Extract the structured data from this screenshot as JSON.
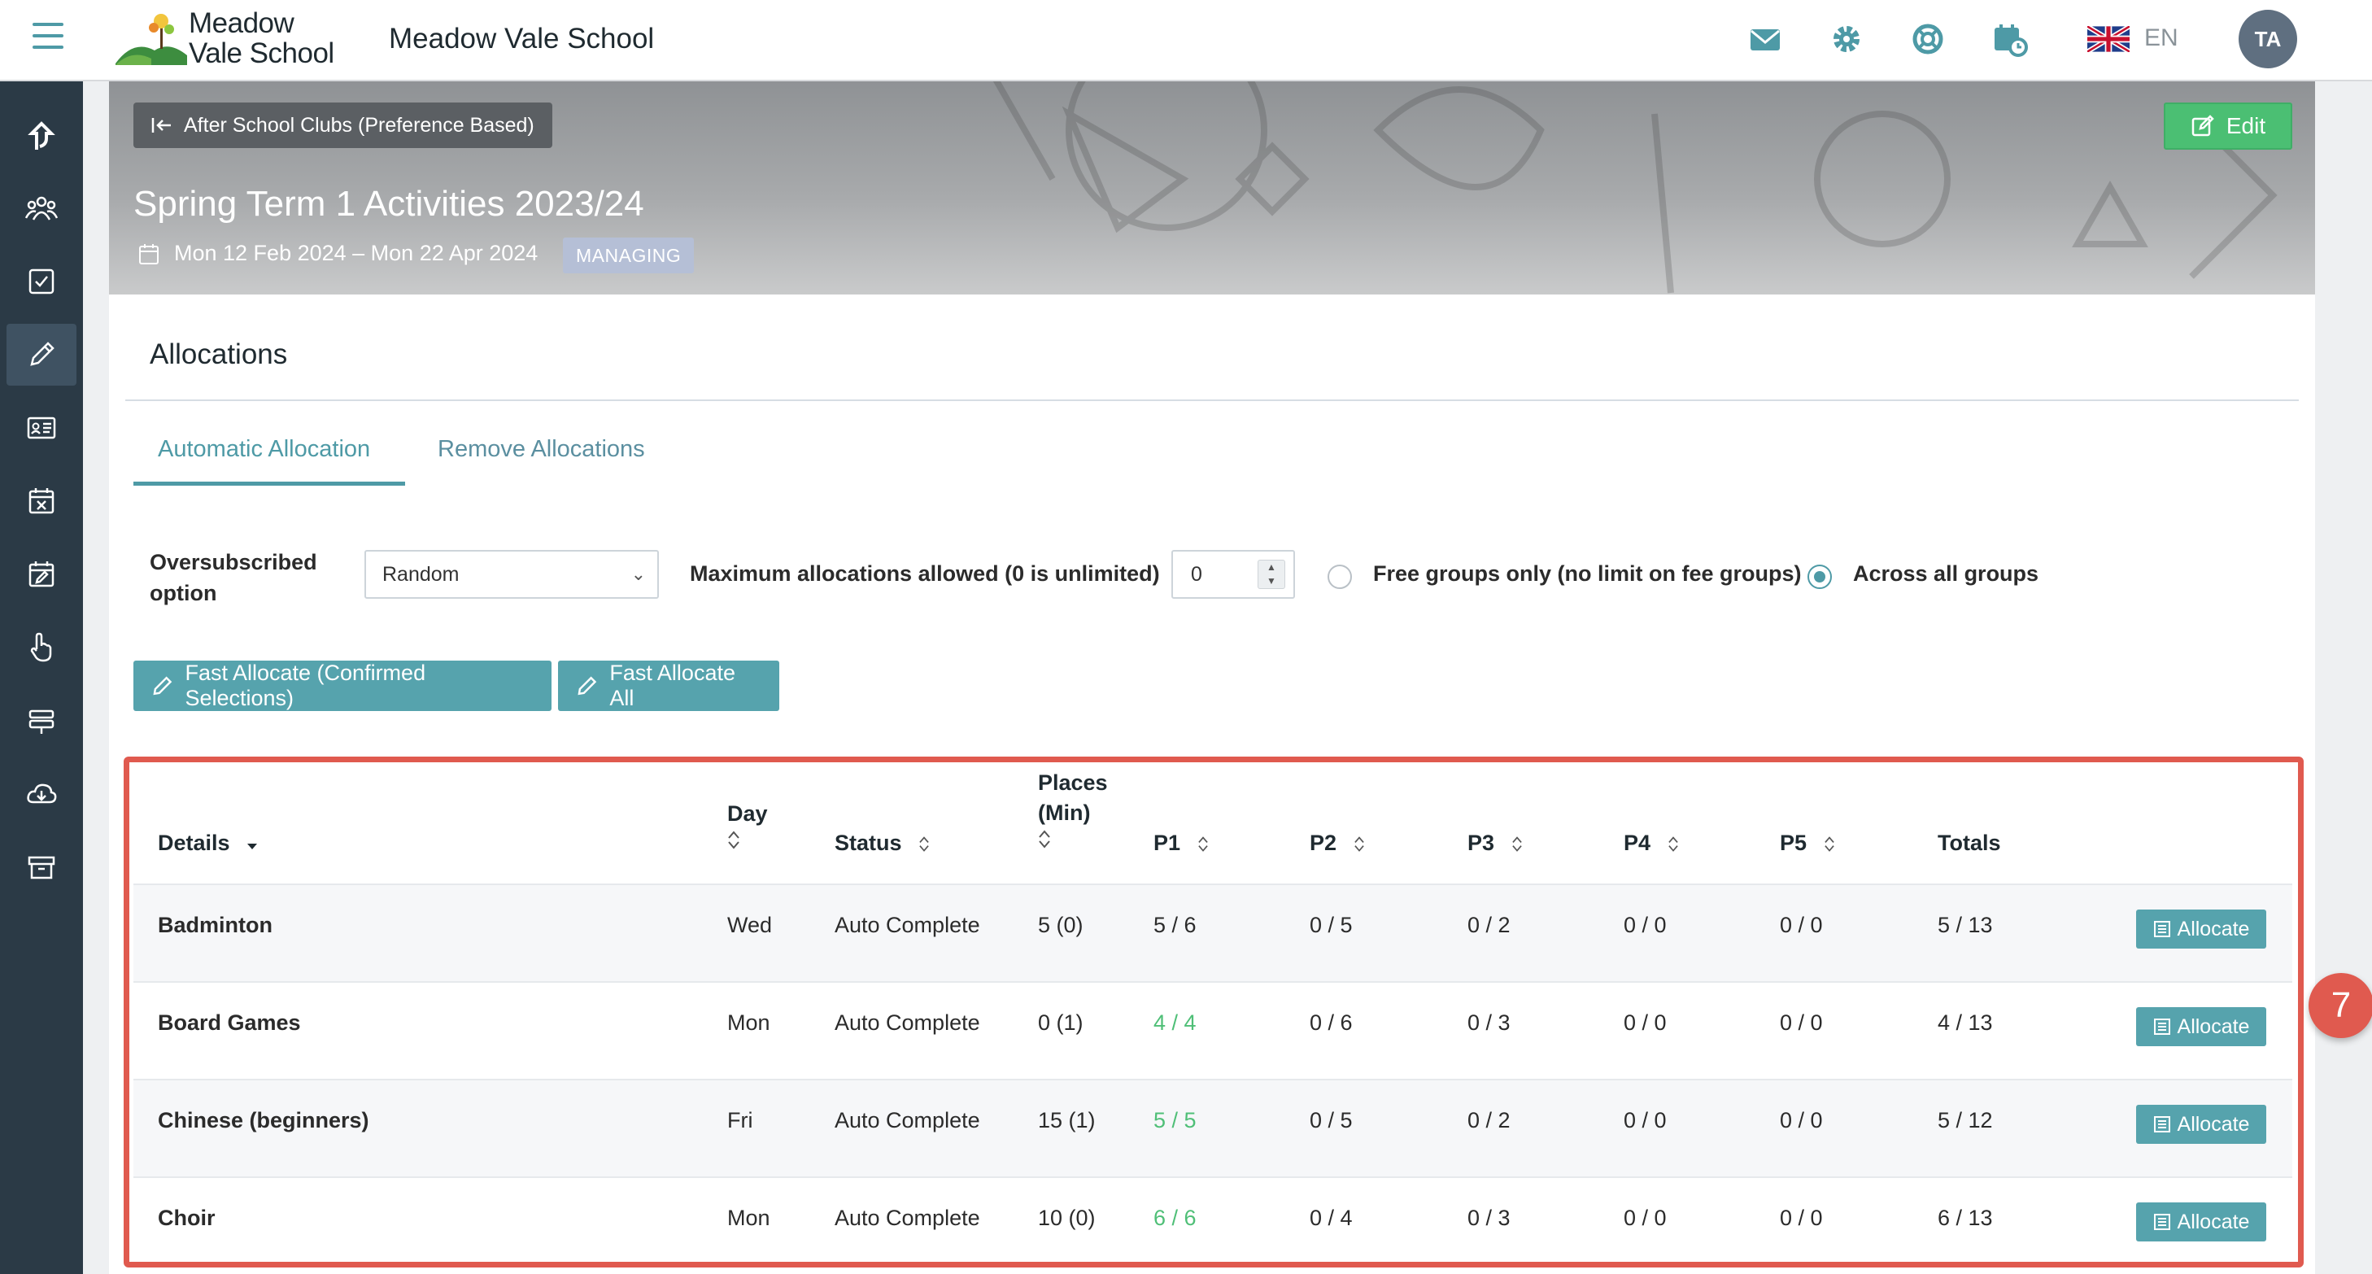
{
  "header": {
    "logo_line1": "Meadow",
    "logo_line2": "Vale School",
    "school_name": "Meadow Vale School",
    "language": "EN",
    "avatar_initials": "TA",
    "icons": [
      "mail-icon",
      "settings-gear-icon",
      "help-lifebuoy-icon",
      "calendar-clock-icon",
      "uk-flag-icon"
    ]
  },
  "sidebar": {
    "items": [
      "share-arrow-icon",
      "users-group-icon",
      "checkbox-icon",
      "pencil-icon",
      "id-card-icon",
      "calendar-x-icon",
      "calendar-edit-icon",
      "hand-pointer-icon",
      "signpost-icon",
      "cloud-download-icon",
      "archive-box-icon"
    ],
    "active_index": 3
  },
  "banner": {
    "back_label": "After School Clubs (Preference Based)",
    "edit_label": "Edit",
    "title": "Spring Term 1 Activities 2023/24",
    "date_range": "Mon 12 Feb 2024 – Mon 22 Apr 2024",
    "badge": "MANAGING"
  },
  "allocations": {
    "section_title": "Allocations",
    "tabs": [
      "Automatic Allocation",
      "Remove Allocations"
    ],
    "oversubscribed_label_1": "Oversubscribed",
    "oversubscribed_label_2": "option",
    "oversubscribed_value": "Random",
    "max_label": "Maximum allocations allowed (0 is unlimited)",
    "max_value": "0",
    "radio_free": "Free groups only (no limit on fee groups)",
    "radio_all": "Across all groups",
    "selected_radio": "all",
    "fast_confirmed": "Fast Allocate (Confirmed Selections)",
    "fast_all": "Fast Allocate All"
  },
  "table": {
    "headers": {
      "details": "Details",
      "day": "Day",
      "status": "Status",
      "places_1": "Places",
      "places_2": "(Min)",
      "p1": "P1",
      "p2": "P2",
      "p3": "P3",
      "p4": "P4",
      "p5": "P5",
      "totals": "Totals"
    },
    "allocate_label": "Allocate",
    "rows": [
      {
        "details": "Badminton",
        "day": "Wed",
        "status": "Auto Complete",
        "places": "5 (0)",
        "p1": "5 / 6",
        "p1_full": false,
        "p2": "0 / 5",
        "p3": "0 / 2",
        "p4": "0 / 0",
        "p5": "0 / 0",
        "totals": "5 / 13"
      },
      {
        "details": "Board Games",
        "day": "Mon",
        "status": "Auto Complete",
        "places": "0 (1)",
        "p1": "4 / 4",
        "p1_full": true,
        "p2": "0 / 6",
        "p3": "0 / 3",
        "p4": "0 / 0",
        "p5": "0 / 0",
        "totals": "4 / 13"
      },
      {
        "details": "Chinese (beginners)",
        "day": "Fri",
        "status": "Auto Complete",
        "places": "15 (1)",
        "p1": "5 / 5",
        "p1_full": true,
        "p2": "0 / 5",
        "p3": "0 / 2",
        "p4": "0 / 0",
        "p5": "0 / 0",
        "totals": "5 / 12"
      },
      {
        "details": "Choir",
        "day": "Mon",
        "status": "Auto Complete",
        "places": "10 (0)",
        "p1": "6 / 6",
        "p1_full": true,
        "p2": "0 / 4",
        "p3": "0 / 3",
        "p4": "0 / 0",
        "p5": "0 / 0",
        "totals": "6 / 13"
      }
    ]
  },
  "callout": {
    "step_number": "7"
  },
  "colors": {
    "accent": "#4e9aa6",
    "button": "#56a3ad",
    "green": "#4bbf73",
    "highlight": "#e05a4f",
    "sidebar": "#2b3a46"
  }
}
